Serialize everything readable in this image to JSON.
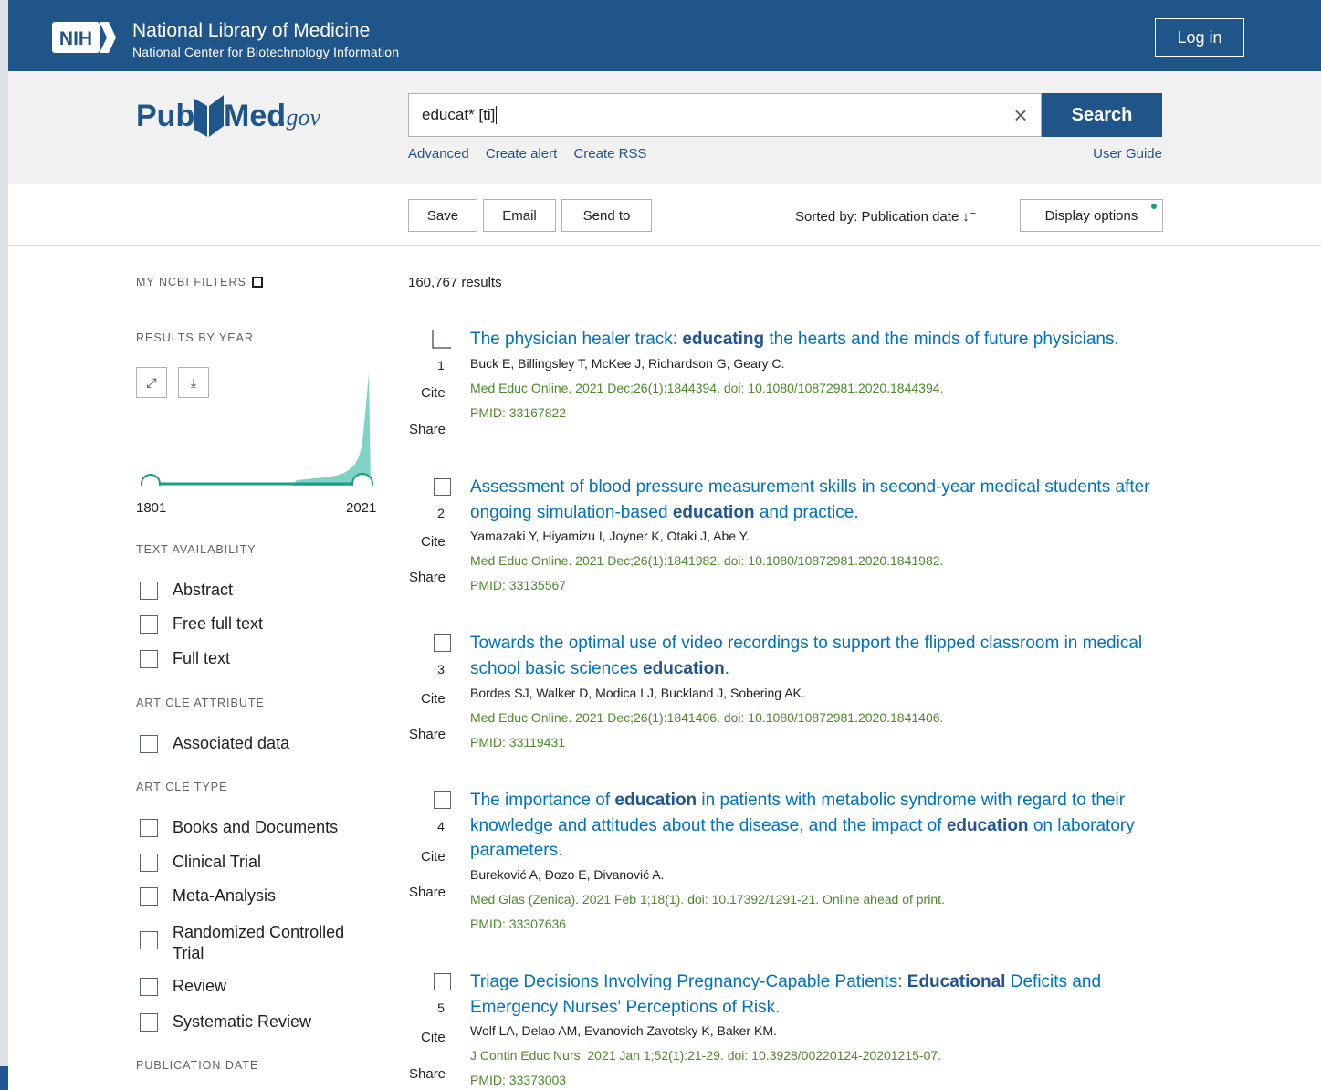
{
  "header": {
    "org_short": "NIH",
    "title": "National Library of Medicine",
    "subtitle": "National Center for Biotechnology Information",
    "login_label": "Log in"
  },
  "search": {
    "logo_pub": "Pub",
    "logo_med": "Med",
    "logo_gov": ".gov",
    "query": "educat* [ti]",
    "clear_icon": "×",
    "button_label": "Search",
    "links": [
      "Advanced",
      "Create alert",
      "Create RSS"
    ],
    "user_guide": "User Guide"
  },
  "toolbar": {
    "save": "Save",
    "email": "Email",
    "send_to": "Send to",
    "sorted_by": "Sorted by: Publication date",
    "display_options": "Display options"
  },
  "sidebar": {
    "my_filters": "MY NCBI FILTERS",
    "results_by_year": "RESULTS BY YEAR",
    "year_start": "1801",
    "year_end": "2021",
    "text_availability": "TEXT AVAILABILITY",
    "text_options": [
      "Abstract",
      "Free full text",
      "Full text"
    ],
    "article_attribute": "ARTICLE ATTRIBUTE",
    "attribute_options": [
      "Associated data"
    ],
    "article_type": "ARTICLE TYPE",
    "type_options": [
      "Books and Documents",
      "Clinical Trial",
      "Meta-Analysis",
      "Randomized Controlled Trial",
      "Review",
      "Systematic Review"
    ],
    "publication_date": "PUBLICATION DATE"
  },
  "results": {
    "count": "160,767 results",
    "cite_label": "Cite",
    "share_label": "Share",
    "items": [
      {
        "num": "1",
        "title_parts": [
          [
            "The physician healer track: ",
            false
          ],
          [
            "educating",
            true
          ],
          [
            " the hearts and the minds of future physicians.",
            false
          ]
        ],
        "authors": "Buck E, Billingsley T, McKee J, Richardson G, Geary C.",
        "citation": "Med Educ Online. 2021 Dec;26(1):1844394. doi: 10.1080/10872981.2020.1844394.",
        "pmid": "PMID: 33167822"
      },
      {
        "num": "2",
        "title_parts": [
          [
            "Assessment of blood pressure measurement skills in second-year medical students after ongoing simulation-based ",
            false
          ],
          [
            "education",
            true
          ],
          [
            " and practice.",
            false
          ]
        ],
        "authors": "Yamazaki Y, Hiyamizu I, Joyner K, Otaki J, Abe Y.",
        "citation": "Med Educ Online. 2021 Dec;26(1):1841982. doi: 10.1080/10872981.2020.1841982.",
        "pmid": "PMID: 33135567"
      },
      {
        "num": "3",
        "title_parts": [
          [
            "Towards the optimal use of video recordings to support the flipped classroom in medical school basic sciences ",
            false
          ],
          [
            "education",
            true
          ],
          [
            ".",
            false
          ]
        ],
        "authors": "Bordes SJ, Walker D, Modica LJ, Buckland J, Sobering AK.",
        "citation": "Med Educ Online. 2021 Dec;26(1):1841406. doi: 10.1080/10872981.2020.1841406.",
        "pmid": "PMID: 33119431"
      },
      {
        "num": "4",
        "title_parts": [
          [
            "The importance of ",
            false
          ],
          [
            "education",
            true
          ],
          [
            " in patients with metabolic syndrome with regard to their knowledge and attitudes about the disease, and the impact of ",
            false
          ],
          [
            "education",
            true
          ],
          [
            " on laboratory parameters.",
            false
          ]
        ],
        "authors": "Bureković A, Đozo E, Divanović A.",
        "citation": "Med Glas (Zenica). 2021 Feb 1;18(1). doi: 10.17392/1291-21. Online ahead of print.",
        "pmid": "PMID: 33307636"
      },
      {
        "num": "5",
        "title_parts": [
          [
            "Triage Decisions Involving Pregnancy-Capable Patients: ",
            false
          ],
          [
            "Educational",
            true
          ],
          [
            " Deficits and Emergency Nurses' Perceptions of Risk.",
            false
          ]
        ],
        "authors": "Wolf LA, Delao AM, Evanovich Zavotsky K, Baker KM.",
        "citation": "J Contin Educ Nurs. 2021 Jan 1;52(1):21-29. doi: 10.3928/00220124-20201215-07.",
        "pmid": "PMID: 33373003"
      }
    ]
  }
}
